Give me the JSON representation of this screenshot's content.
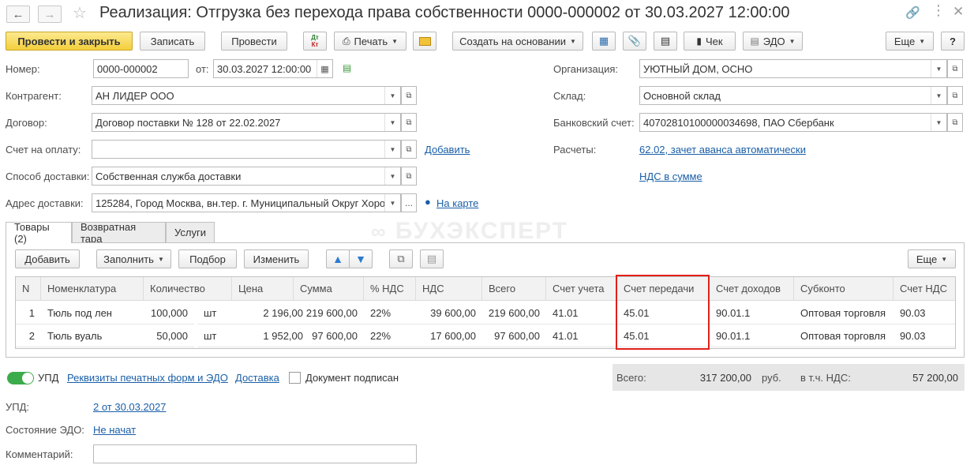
{
  "window": {
    "title": "Реализация: Отгрузка без перехода права собственности 0000-000002 от 30.03.2027 12:00:00"
  },
  "toolbar": {
    "post_close": "Провести и закрыть",
    "write": "Записать",
    "post": "Провести",
    "dtkt_top": "Дт",
    "dtkt_bottom": "Кт",
    "print": "Печать",
    "create_based": "Создать на основании",
    "check": "Чек",
    "edo": "ЭДО",
    "more": "Еще",
    "help": "?"
  },
  "form": {
    "number_label": "Номер:",
    "number": "0000-000002",
    "from_label": "от:",
    "date": "30.03.2027 12:00:00",
    "counterparty_label": "Контрагент:",
    "counterparty": "АН ЛИДЕР ООО",
    "contract_label": "Договор:",
    "contract": "Договор поставки № 128 от 22.02.2027",
    "invoice_label": "Счет на оплату:",
    "invoice": "",
    "add_link": "Добавить",
    "delivery_method_label": "Способ доставки:",
    "delivery_method": "Собственная служба доставки",
    "delivery_address_label": "Адрес доставки:",
    "delivery_address": "125284, Город Москва, вн.тер. г. Муниципальный Округ Хорошевский",
    "map_link": "На карте",
    "organization_label": "Организация:",
    "organization": "УЮТНЫЙ ДОМ, ОСНО",
    "warehouse_label": "Склад:",
    "warehouse": "Основной склад",
    "bank_account_label": "Банковский счет:",
    "bank_account": "40702810100000034698, ПАО Сбербанк",
    "settlements_label": "Расчеты:",
    "settlements_link": "62.02, зачет аванса автоматически",
    "vat_link": "НДС в сумме"
  },
  "tabs": [
    {
      "label": "Товары (2)"
    },
    {
      "label": "Возвратная тара"
    },
    {
      "label": "Услуги"
    }
  ],
  "table_toolbar": {
    "add": "Добавить",
    "fill": "Заполнить",
    "select": "Подбор",
    "edit": "Изменить",
    "more": "Еще"
  },
  "watermark": "БУХЭКСПЕРТ",
  "table": {
    "headers": [
      "N",
      "Номенклатура",
      "Количество",
      "Цена",
      "Сумма",
      "% НДС",
      "НДС",
      "Всего",
      "Счет учета",
      "Счет передачи",
      "Счет доходов",
      "Субконто",
      "Счет НДС"
    ],
    "rows": [
      {
        "n": "1",
        "item": "Тюль под лен",
        "qty": "100,000",
        "unit": "шт",
        "price": "2 196,00",
        "sum": "219 600,00",
        "vat_rate": "22%",
        "vat": "39 600,00",
        "total": "219 600,00",
        "acc": "41.01",
        "transfer_acc": "45.01",
        "income_acc": "90.01.1",
        "subconto": "Оптовая торговля",
        "vat_acc": "90.03"
      },
      {
        "n": "2",
        "item": "Тюль вуаль",
        "qty": "50,000",
        "unit": "шт",
        "price": "1 952,00",
        "sum": "97 600,00",
        "vat_rate": "22%",
        "vat": "17 600,00",
        "total": "97 600,00",
        "acc": "41.01",
        "transfer_acc": "45.01",
        "income_acc": "90.01.1",
        "subconto": "Оптовая торговля",
        "vat_acc": "90.03"
      }
    ]
  },
  "footer": {
    "upd_toggle": "УПД",
    "print_forms_link": "Реквизиты печатных форм и ЭДО",
    "delivery_link": "Доставка",
    "signed_label": "Документ подписан",
    "total_label": "Всего:",
    "total_value": "317 200,00",
    "currency": "руб.",
    "vat_label": "в т.ч. НДС:",
    "vat_value": "57 200,00",
    "upd_label": "УПД:",
    "upd_link": "2 от 30.03.2027",
    "edo_state_label": "Состояние ЭДО:",
    "edo_state_link": "Не начат",
    "comment_label": "Комментарий:",
    "comment": ""
  },
  "colors": {
    "primary_button": "#f3cf3c",
    "link": "#1a5fa8",
    "highlight_border": "#e0201a",
    "toggle_on": "#3cab4a"
  }
}
